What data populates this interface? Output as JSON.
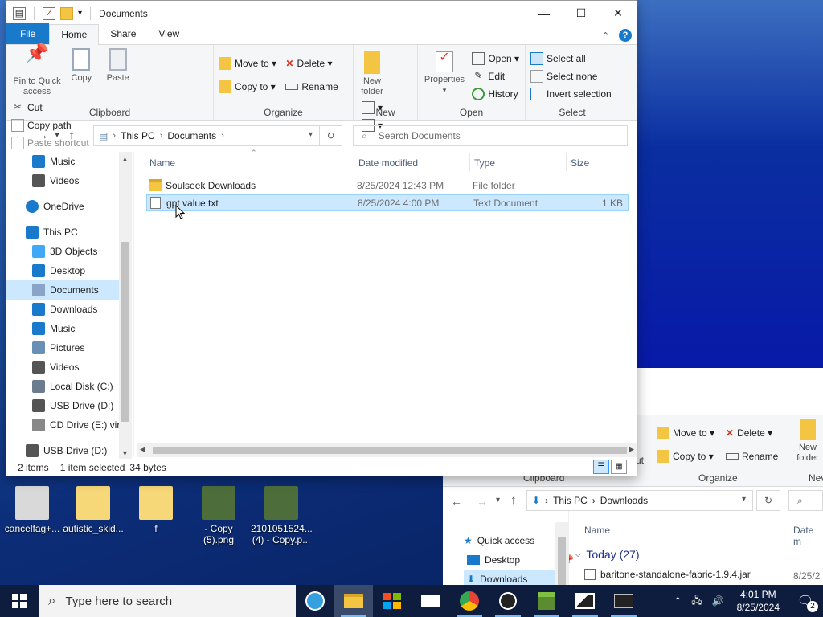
{
  "window": {
    "title": "Documents"
  },
  "ribbon_tabs": [
    "File",
    "Home",
    "Share",
    "View"
  ],
  "ribbon": {
    "clipboard": {
      "name": "Clipboard",
      "pin": "Pin to Quick access",
      "copy": "Copy",
      "paste": "Paste",
      "cut": "Cut",
      "copy_path": "Copy path",
      "paste_shortcut": "Paste shortcut"
    },
    "organize": {
      "name": "Organize",
      "move_to": "Move to",
      "copy_to": "Copy to",
      "delete": "Delete",
      "rename": "Rename"
    },
    "new": {
      "name": "New",
      "new_folder": "New folder"
    },
    "open": {
      "name": "Open",
      "properties": "Properties",
      "open": "Open",
      "edit": "Edit",
      "history": "History"
    },
    "select": {
      "name": "Select",
      "select_all": "Select all",
      "select_none": "Select none",
      "invert": "Invert selection"
    }
  },
  "address": {
    "crumbs": [
      "This PC",
      "Documents"
    ]
  },
  "search": {
    "placeholder": "Search Documents"
  },
  "nav_pane": [
    {
      "label": "Music",
      "icon": "music-icon",
      "sel": false
    },
    {
      "label": "Videos",
      "icon": "videos-icon",
      "sel": false
    },
    {
      "label": "OneDrive",
      "icon": "cloud-icon",
      "sel": false
    },
    {
      "label": "This PC",
      "icon": "pc-icon",
      "sel": false
    },
    {
      "label": "3D Objects",
      "icon": "cube-icon",
      "sel": false
    },
    {
      "label": "Desktop",
      "icon": "desktop-icon",
      "sel": false
    },
    {
      "label": "Documents",
      "icon": "documents-icon",
      "sel": true
    },
    {
      "label": "Downloads",
      "icon": "download-icon",
      "sel": false
    },
    {
      "label": "Music",
      "icon": "music-icon",
      "sel": false
    },
    {
      "label": "Pictures",
      "icon": "pictures-icon",
      "sel": false
    },
    {
      "label": "Videos",
      "icon": "videos-icon",
      "sel": false
    },
    {
      "label": "Local Disk (C:)",
      "icon": "drive-icon",
      "sel": false
    },
    {
      "label": "USB Drive (D:)",
      "icon": "usb-drive-icon",
      "sel": false
    },
    {
      "label": "CD Drive (E:) virt",
      "icon": "cd-drive-icon",
      "sel": false
    },
    {
      "label": "USB Drive (D:)",
      "icon": "usb-drive-icon",
      "sel": false
    }
  ],
  "columns": {
    "name": "Name",
    "date": "Date modified",
    "type": "Type",
    "size": "Size"
  },
  "files": [
    {
      "name": "Soulseek Downloads",
      "date": "8/25/2024 12:43 PM",
      "type": "File folder",
      "size": "",
      "icon": "folder-icon",
      "selected": false
    },
    {
      "name": "gpt value.txt",
      "date": "8/25/2024 4:00 PM",
      "type": "Text Document",
      "size": "1 KB",
      "icon": "text-file-icon",
      "selected": true
    }
  ],
  "status": {
    "count": "2 items",
    "selected": "1 item selected",
    "size": "34 bytes"
  },
  "desktop_icons": [
    {
      "label": "cancelfag+...",
      "icon": "settings-file-icon"
    },
    {
      "label": "autistic_skid...",
      "icon": "folder-icon"
    },
    {
      "label": "f",
      "icon": "folder-icon"
    },
    {
      "label": "- Copy (5).png",
      "icon": "image-file-icon"
    },
    {
      "label": "2101051524... (4) - Copy.p...",
      "icon": "image-file-icon"
    }
  ],
  "second_window": {
    "ribbon_fragment": "ut",
    "move_to": "Move to",
    "copy_to": "Copy to",
    "delete": "Delete",
    "rename": "Rename",
    "new_folder": "New folder",
    "clipboard": "Clipboard",
    "organize": "Organize",
    "new": "Nev",
    "crumbs": [
      "This PC",
      "Downloads"
    ],
    "quick_access": "Quick access",
    "desktop": "Desktop",
    "downloads": "Downloads",
    "col_name": "Name",
    "col_date": "Date m",
    "group": "Today (27)",
    "file": "baritone-standalone-fabric-1.9.4.jar",
    "file_date": "8/25/2"
  },
  "taskbar": {
    "search_placeholder": "Type here to search",
    "time": "4:01 PM",
    "date": "8/25/2024",
    "notifications": "2"
  }
}
